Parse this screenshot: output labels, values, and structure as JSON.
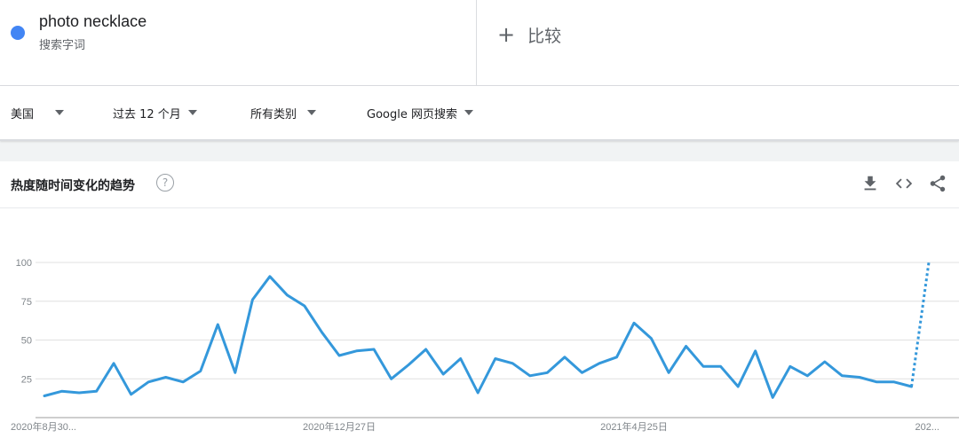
{
  "header": {
    "term": {
      "name": "photo necklace",
      "type": "搜索字词",
      "color": "#4285f4"
    },
    "compare": {
      "label": "比较"
    }
  },
  "filters": [
    {
      "label": "美国"
    },
    {
      "label": "过去 12 个月"
    },
    {
      "label": "所有类别"
    },
    {
      "label": "Google 网页搜索"
    }
  ],
  "card": {
    "title": "热度随时间变化的趋势",
    "help_icon": "help-icon",
    "tools": [
      "download-icon",
      "embed-icon",
      "share-icon"
    ]
  },
  "chart_data": {
    "type": "line",
    "title": "",
    "xlabel": "",
    "ylabel": "",
    "ylim": [
      0,
      100
    ],
    "yticks": [
      25,
      50,
      75,
      100
    ],
    "grid": true,
    "line_color": "#3498db",
    "x_tick_labels": [
      "2020年8月30...",
      "2020年12月27日",
      "2021年4月25日",
      "202..."
    ],
    "x_tick_indices": [
      0,
      17,
      34,
      51
    ],
    "series": [
      {
        "values": [
          14,
          17,
          16,
          17,
          35,
          15,
          23,
          26,
          23,
          30,
          60,
          29,
          76,
          91,
          79,
          72,
          55,
          40,
          43,
          44,
          25,
          34,
          44,
          28,
          38,
          16,
          38,
          35,
          27,
          29,
          39,
          29,
          35,
          39,
          61,
          51,
          29,
          46,
          33,
          33,
          20,
          43,
          13,
          33,
          27,
          36,
          27,
          26,
          23,
          23,
          20,
          100
        ],
        "partial_from_index": 50
      }
    ]
  }
}
